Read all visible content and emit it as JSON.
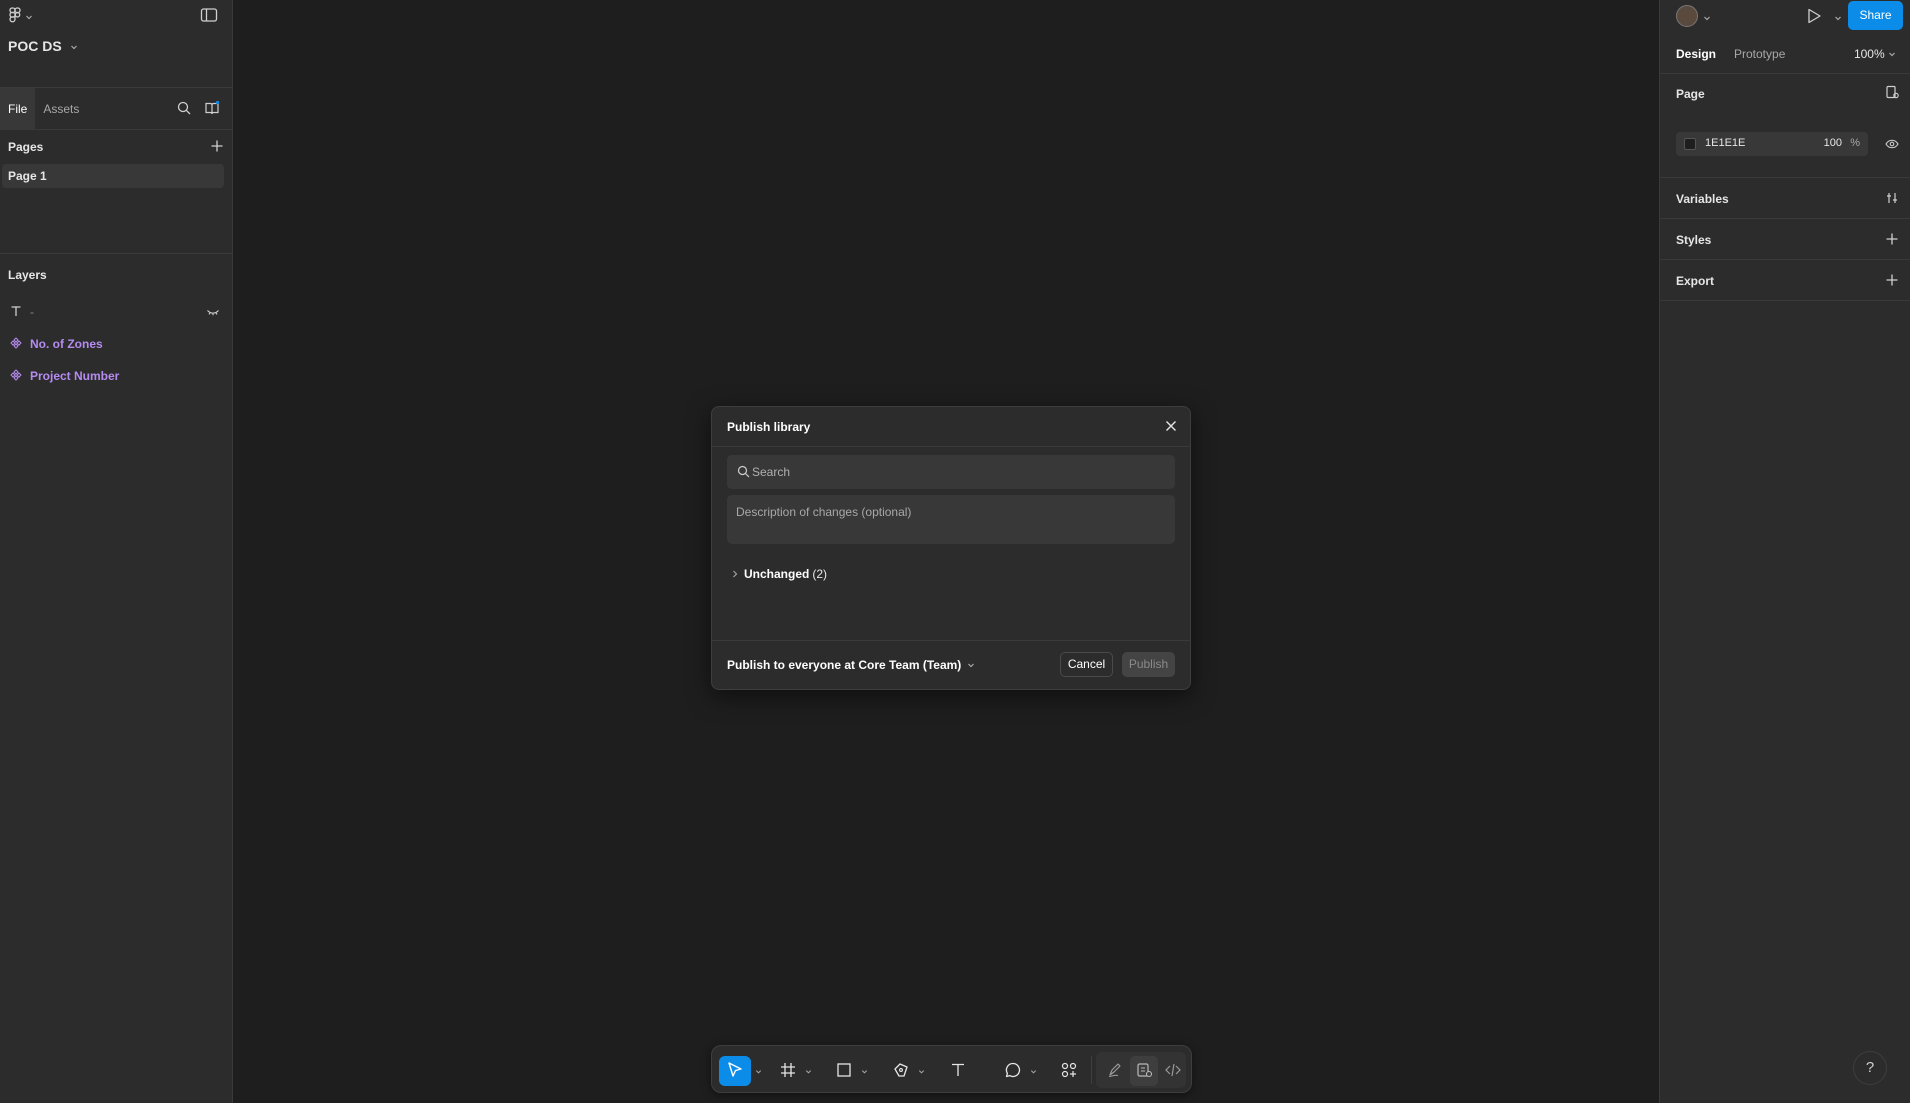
{
  "file": {
    "name": "POC DS"
  },
  "left_panel": {
    "tabs": [
      {
        "label": "File"
      },
      {
        "label": "Assets"
      }
    ],
    "pages_header": "Pages",
    "pages": [
      {
        "label": "Page 1"
      }
    ],
    "layers_header": "Layers",
    "layers": [
      {
        "label": "-",
        "type": "text"
      },
      {
        "label": "No. of Zones",
        "type": "component"
      },
      {
        "label": "Project Number",
        "type": "component"
      }
    ]
  },
  "right_panel": {
    "share_label": "Share",
    "tabs": [
      {
        "label": "Design"
      },
      {
        "label": "Prototype"
      }
    ],
    "zoom": "100%",
    "page_section": {
      "title": "Page",
      "fill_hex": "1E1E1E",
      "opacity": "100",
      "opacity_unit": "%"
    },
    "variables_title": "Variables",
    "styles_title": "Styles",
    "export_title": "Export"
  },
  "modal": {
    "title": "Publish library",
    "search_placeholder": "Search",
    "description_placeholder": "Description of changes (optional)",
    "unchanged_label": "Unchanged",
    "unchanged_count": "(2)",
    "publish_target": "Publish to everyone at Core Team (Team)",
    "cancel_label": "Cancel",
    "publish_label": "Publish"
  },
  "help_label": "?",
  "colors": {
    "accent": "#0c8ce9",
    "canvas": "#1e1e1e",
    "panel": "#2c2c2c",
    "component": "#b58bf0"
  }
}
